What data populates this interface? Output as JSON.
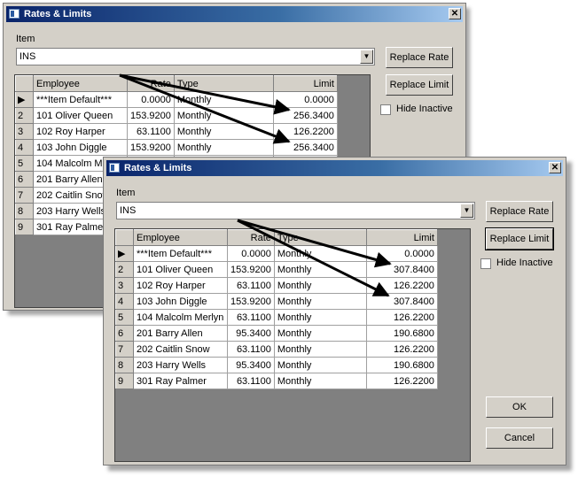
{
  "back_window": {
    "title": "Rates & Limits",
    "item_label": "Item",
    "item_value": "INS",
    "replace_rate": "Replace Rate",
    "replace_limit": "Replace Limit",
    "hide_inactive": "Hide Inactive",
    "columns": [
      "Employee",
      "Rate",
      "Type",
      "Limit"
    ],
    "rows": [
      {
        "num": "▶",
        "employee": "***Item Default***",
        "rate": "0.0000",
        "type": "Monthly",
        "limit": "0.0000"
      },
      {
        "num": "2",
        "employee": "101 Oliver Queen",
        "rate": "153.9200",
        "type": "Monthly",
        "limit": "256.3400"
      },
      {
        "num": "3",
        "employee": "102 Roy Harper",
        "rate": "63.1100",
        "type": "Monthly",
        "limit": "126.2200"
      },
      {
        "num": "4",
        "employee": "103 John Diggle",
        "rate": "153.9200",
        "type": "Monthly",
        "limit": "256.3400"
      },
      {
        "num": "5",
        "employee": "104 Malcolm Merlyn",
        "rate": "",
        "type": "",
        "limit": ""
      },
      {
        "num": "6",
        "employee": "201 Barry Allen",
        "rate": "",
        "type": "",
        "limit": ""
      },
      {
        "num": "7",
        "employee": "202 Caitlin Snow",
        "rate": "",
        "type": "",
        "limit": ""
      },
      {
        "num": "8",
        "employee": "203 Harry Wells",
        "rate": "",
        "type": "",
        "limit": ""
      },
      {
        "num": "9",
        "employee": "301 Ray Palmer",
        "rate": "",
        "type": "",
        "limit": ""
      }
    ]
  },
  "front_window": {
    "title": "Rates & Limits",
    "item_label": "Item",
    "item_value": "INS",
    "replace_rate": "Replace Rate",
    "replace_limit": "Replace Limit",
    "hide_inactive": "Hide Inactive",
    "ok": "OK",
    "cancel": "Cancel",
    "columns": [
      "Employee",
      "Rate",
      "Type",
      "Limit"
    ],
    "rows": [
      {
        "num": "▶",
        "employee": "***Item Default***",
        "rate": "0.0000",
        "type": "Monthly",
        "limit": "0.0000"
      },
      {
        "num": "2",
        "employee": "101 Oliver Queen",
        "rate": "153.9200",
        "type": "Monthly",
        "limit": "307.8400"
      },
      {
        "num": "3",
        "employee": "102 Roy Harper",
        "rate": "63.1100",
        "type": "Monthly",
        "limit": "126.2200"
      },
      {
        "num": "4",
        "employee": "103 John Diggle",
        "rate": "153.9200",
        "type": "Monthly",
        "limit": "307.8400"
      },
      {
        "num": "5",
        "employee": "104 Malcolm Merlyn",
        "rate": "63.1100",
        "type": "Monthly",
        "limit": "126.2200"
      },
      {
        "num": "6",
        "employee": "201 Barry Allen",
        "rate": "95.3400",
        "type": "Monthly",
        "limit": "190.6800"
      },
      {
        "num": "7",
        "employee": "202 Caitlin Snow",
        "rate": "63.1100",
        "type": "Monthly",
        "limit": "126.2200"
      },
      {
        "num": "8",
        "employee": "203 Harry Wells",
        "rate": "95.3400",
        "type": "Monthly",
        "limit": "190.6800"
      },
      {
        "num": "9",
        "employee": "301 Ray Palmer",
        "rate": "63.1100",
        "type": "Monthly",
        "limit": "126.2200"
      }
    ]
  },
  "icons": {
    "app": "app-window-icon",
    "close": "close-icon",
    "dropdown": "chevron-down-icon",
    "row_pointer": "current-row-icon"
  },
  "colors": {
    "title_start": "#0a246a",
    "title_end": "#a6caf0",
    "face": "#d4d0c8",
    "grid_bg": "#808080"
  }
}
